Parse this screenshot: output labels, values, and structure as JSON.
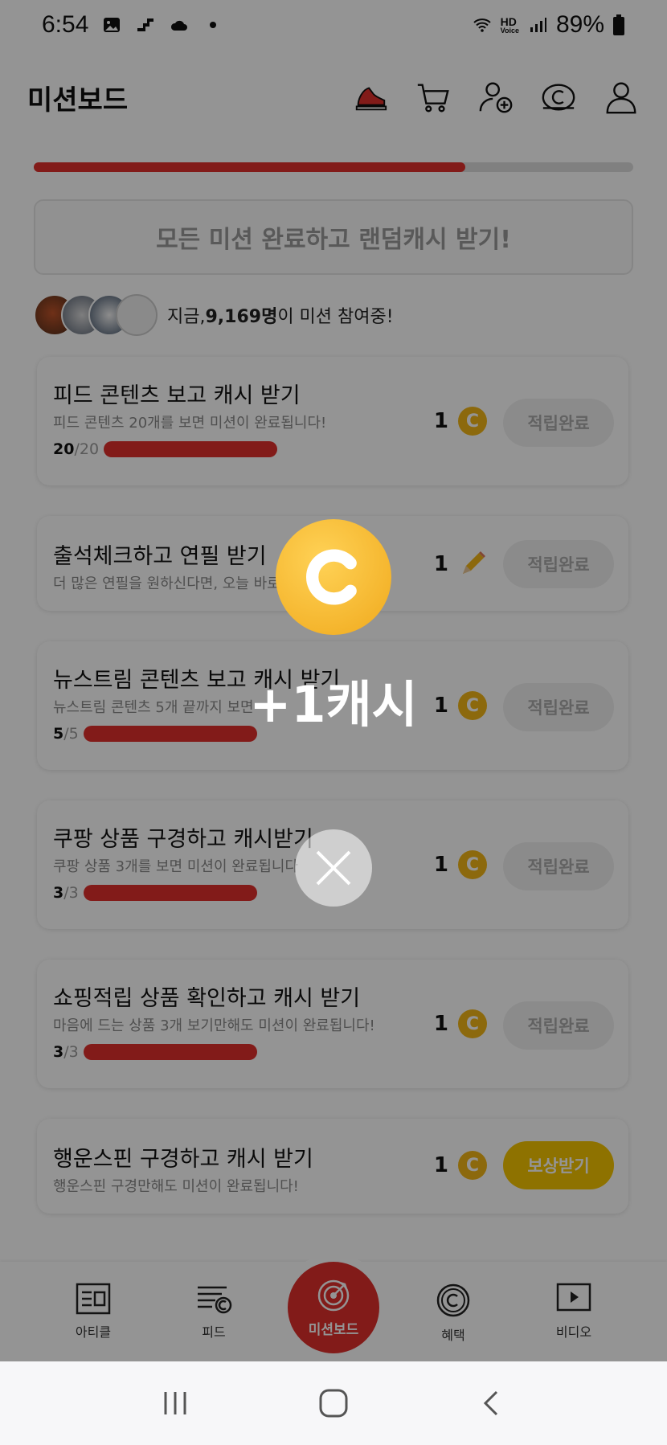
{
  "status_bar": {
    "time": "6:54",
    "battery": "89%",
    "hd_label": "HD",
    "voice_label": "Voice"
  },
  "header": {
    "title": "미션보드"
  },
  "progress": {
    "fraction": 0.72
  },
  "banner": {
    "text": "모든 미션 완료하고 랜덤캐시 받기!"
  },
  "participants": {
    "prefix": "지금, ",
    "count": "9,169명",
    "suffix": "이 미션 참여중!"
  },
  "missions": [
    {
      "title": "피드 콘텐츠 보고 캐시 받기",
      "subtitle": "피드 콘텐츠 20개를 보면 미션이 완료됩니다!",
      "progress_done": "20",
      "progress_total": "/20",
      "reward": "1",
      "reward_icon": "coin-icon",
      "button": "적립완료"
    },
    {
      "title": "출석체크하고 연필 받기",
      "subtitle": "더 많은 연필을 원하신다면, 오늘 바로",
      "reward": "1",
      "reward_icon": "pencil-icon",
      "button": "적립완료"
    },
    {
      "title": "뉴스트림 콘텐츠 보고 캐시 받기",
      "subtitle": "뉴스트림 콘텐츠 5개 끝까지 보면",
      "progress_done": "5",
      "progress_total": "/5",
      "reward": "1",
      "reward_icon": "coin-icon",
      "button": "적립완료"
    },
    {
      "title": "쿠팡 상품 구경하고 캐시받기",
      "subtitle": "쿠팡 상품 3개를 보면 미션이 완료됩니다",
      "progress_done": "3",
      "progress_total": "/3",
      "reward": "1",
      "reward_icon": "coin-icon",
      "button": "적립완료"
    },
    {
      "title": "쇼핑적립 상품 확인하고 캐시 받기",
      "subtitle": "마음에 드는 상품 3개 보기만해도 미션이 완료됩니다!",
      "progress_done": "3",
      "progress_total": "/3",
      "reward": "1",
      "reward_icon": "coin-icon",
      "button": "적립완료"
    },
    {
      "title": "행운스핀 구경하고 캐시 받기",
      "subtitle": "행운스핀 구경만해도 미션이 완료됩니다!",
      "reward": "1",
      "reward_icon": "coin-icon",
      "button": "보상받기"
    }
  ],
  "bottom_nav": {
    "items": [
      "아티클",
      "피드",
      "미션보드",
      "혜택",
      "비디오"
    ]
  },
  "popup": {
    "text": "+1캐시"
  },
  "colors": {
    "accent": "#e0302c",
    "coin": "#f2b617",
    "claim": "#f5c400"
  }
}
